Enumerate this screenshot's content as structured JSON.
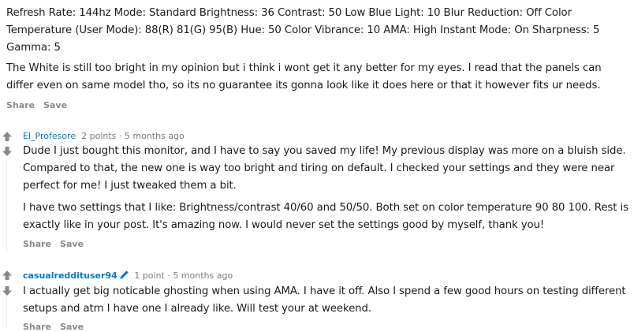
{
  "comment0": {
    "paragraphs": [
      "Refresh Rate: 144hz Mode: Standard Brightness: 36 Contrast: 50 Low Blue Light: 10 Blur Reduction: Off Color Temperature (User Mode): 88(R) 81(G) 95(B) Hue: 50 Color Vibrance: 10 AMA: High Instant Mode: On Sharpness: 5 Gamma: 5",
      "The White is still too bright in my opinion but i think i wont get it any better for my eyes. I read that the panels can differ even on same model tho, so its no guarantee its gonna look like it does here or that it however fits ur needs."
    ],
    "share": "Share",
    "save": "Save"
  },
  "comment1": {
    "author": "El_Profesore",
    "points": "2 points",
    "sep": "·",
    "time": "5 months ago",
    "paragraphs": [
      "Dude I just bought this monitor, and I have to say you saved my life! My previous display was more on a bluish side. Compared to that, the new one is way too bright and tiring on default. I checked your settings and they were near perfect for me! I just tweaked them a bit.",
      "I have two settings that I like: Brightness/contrast 40/60 and 50/50. Both set on color temperature 90 80 100. Rest is exactly like in your post. It's amazing now. I would never set the settings good by myself, thank you!"
    ],
    "share": "Share",
    "save": "Save"
  },
  "comment2": {
    "author": "casualreddituser94",
    "points": "1 point",
    "sep": "·",
    "time": "5 months ago",
    "paragraphs": [
      "I actually get big noticable ghosting when using AMA. I have it off. Also I spend a few good hours on testing different setups and atm I have one I already like. Will test your at weekend."
    ],
    "share": "Share",
    "save": "Save"
  },
  "icons": {
    "upvote": "upvote-arrow-icon",
    "downvote": "downvote-arrow-icon",
    "pencil": "pencil-icon"
  },
  "colors": {
    "author": "#0079d3",
    "meta": "#7c7c7c",
    "actions": "#878a8c",
    "vote": "#878a8c"
  }
}
